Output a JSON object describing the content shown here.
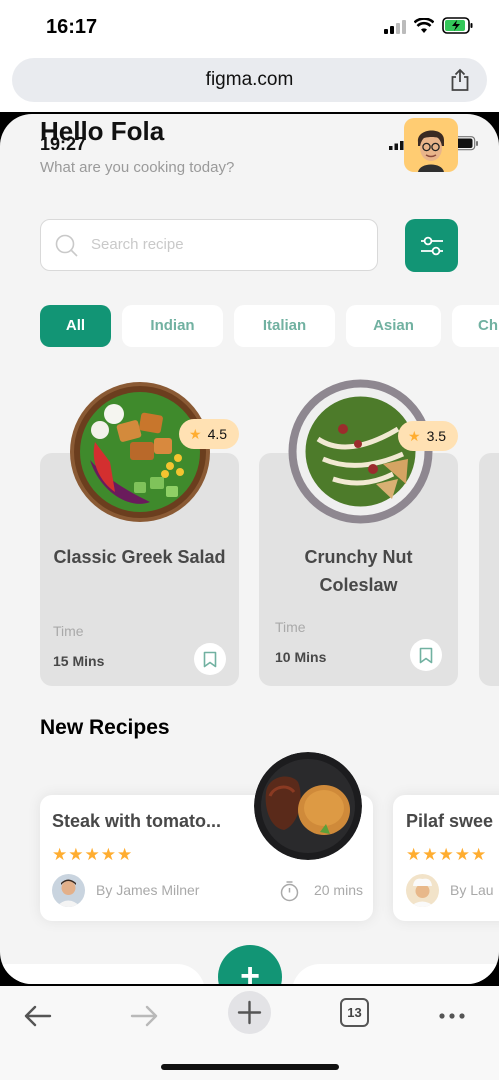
{
  "ios": {
    "time": "16:17"
  },
  "browser": {
    "url": "figma.com",
    "tab_count": "13"
  },
  "app": {
    "status_time": "19:27",
    "greeting": "Hello Fola",
    "subtitle": "What are you cooking today?",
    "search_placeholder": "Search recipe",
    "categories": [
      "All",
      "Indian",
      "Italian",
      "Asian",
      "Ch"
    ],
    "time_label": "Time",
    "featured": [
      {
        "title": "Classic Greek Salad",
        "rating": "4.5",
        "time": "15 Mins"
      },
      {
        "title": "Crunchy Nut Coleslaw",
        "rating": "3.5",
        "time": "10 Mins"
      }
    ],
    "new_recipes_title": "New Recipes",
    "new_recipes": [
      {
        "title": "Steak with tomato...",
        "stars": "★★★★★",
        "author": "By James Milner",
        "time": "20 mins"
      },
      {
        "title": "Pilaf swee",
        "stars": "★★★★★",
        "author": "By Lau"
      }
    ],
    "fab_label": "+"
  },
  "colors": {
    "primary": "#129575",
    "star": "#ffad30",
    "rating_bg": "#ffe1b3"
  }
}
